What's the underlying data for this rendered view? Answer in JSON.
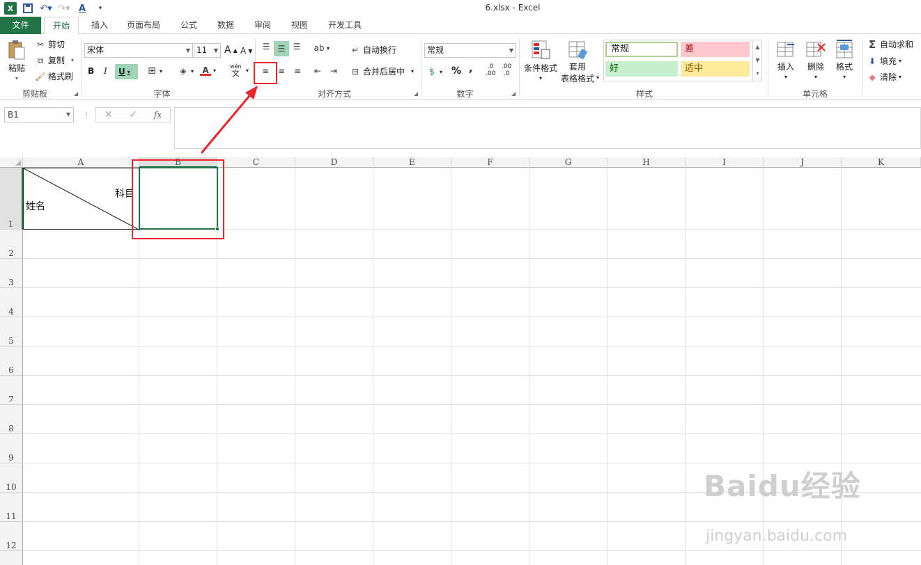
{
  "window": {
    "title": "6.xlsx - Excel"
  },
  "tabs": [
    "文件",
    "开始",
    "插入",
    "页面布局",
    "公式",
    "数据",
    "审阅",
    "视图",
    "开发工具"
  ],
  "clipboard": {
    "paste": "粘贴",
    "cut": "剪切",
    "copy": "复制",
    "format_painter": "格式刷",
    "label": "剪贴板"
  },
  "font": {
    "name": "宋体",
    "size": "11",
    "label": "字体",
    "bold": "B",
    "italic": "I",
    "underline": "U",
    "grow": "A",
    "shrink": "A",
    "phonetic_top": "wén",
    "phonetic_bottom": "文"
  },
  "alignment": {
    "wrap": "自动换行",
    "merge": "合并后居中",
    "label": "对齐方式"
  },
  "number": {
    "format": "常规",
    "percent": "%",
    "comma": ",",
    "inc_decimal_top": ".0",
    "inc_decimal_bottom": ".00",
    "dec_decimal_top": ".00",
    "dec_decimal_bottom": ".0",
    "label": "数字"
  },
  "styles": {
    "conditional": "条件格式",
    "table_format_top": "套用",
    "table_format_bottom": "表格格式",
    "normal": "常规",
    "bad": "差",
    "good": "好",
    "neutral": "适中",
    "label": "样式",
    "colors": {
      "normal_border": "#a9d08e",
      "bad_bg": "#ffc7ce",
      "bad_text": "#9c0006",
      "good_bg": "#c6efce",
      "good_text": "#006100",
      "neutral_bg": "#ffeb9c",
      "neutral_text": "#9c5700"
    }
  },
  "cells_group": {
    "insert": "插入",
    "delete": "删除",
    "format": "格式",
    "label": "单元格"
  },
  "editing": {
    "autosum": "自动求和",
    "fill": "填充",
    "clear": "清除"
  },
  "formula_bar": {
    "name_box": "B1",
    "fx": "fx"
  },
  "columns": [
    "A",
    "B",
    "C",
    "D",
    "E",
    "F",
    "G",
    "H",
    "I",
    "J",
    "K"
  ],
  "rows": [
    "1",
    "2",
    "3",
    "4",
    "5",
    "6",
    "7",
    "8",
    "9",
    "10",
    "11",
    "12"
  ],
  "cell_a1": {
    "top_right_text": "科目",
    "bottom_left_text": "姓名"
  },
  "watermark": {
    "logo": "Baidu经验",
    "url": "jingyan.baidu.com"
  },
  "accent_color": "#217346",
  "annotation_color": "#e8262c"
}
